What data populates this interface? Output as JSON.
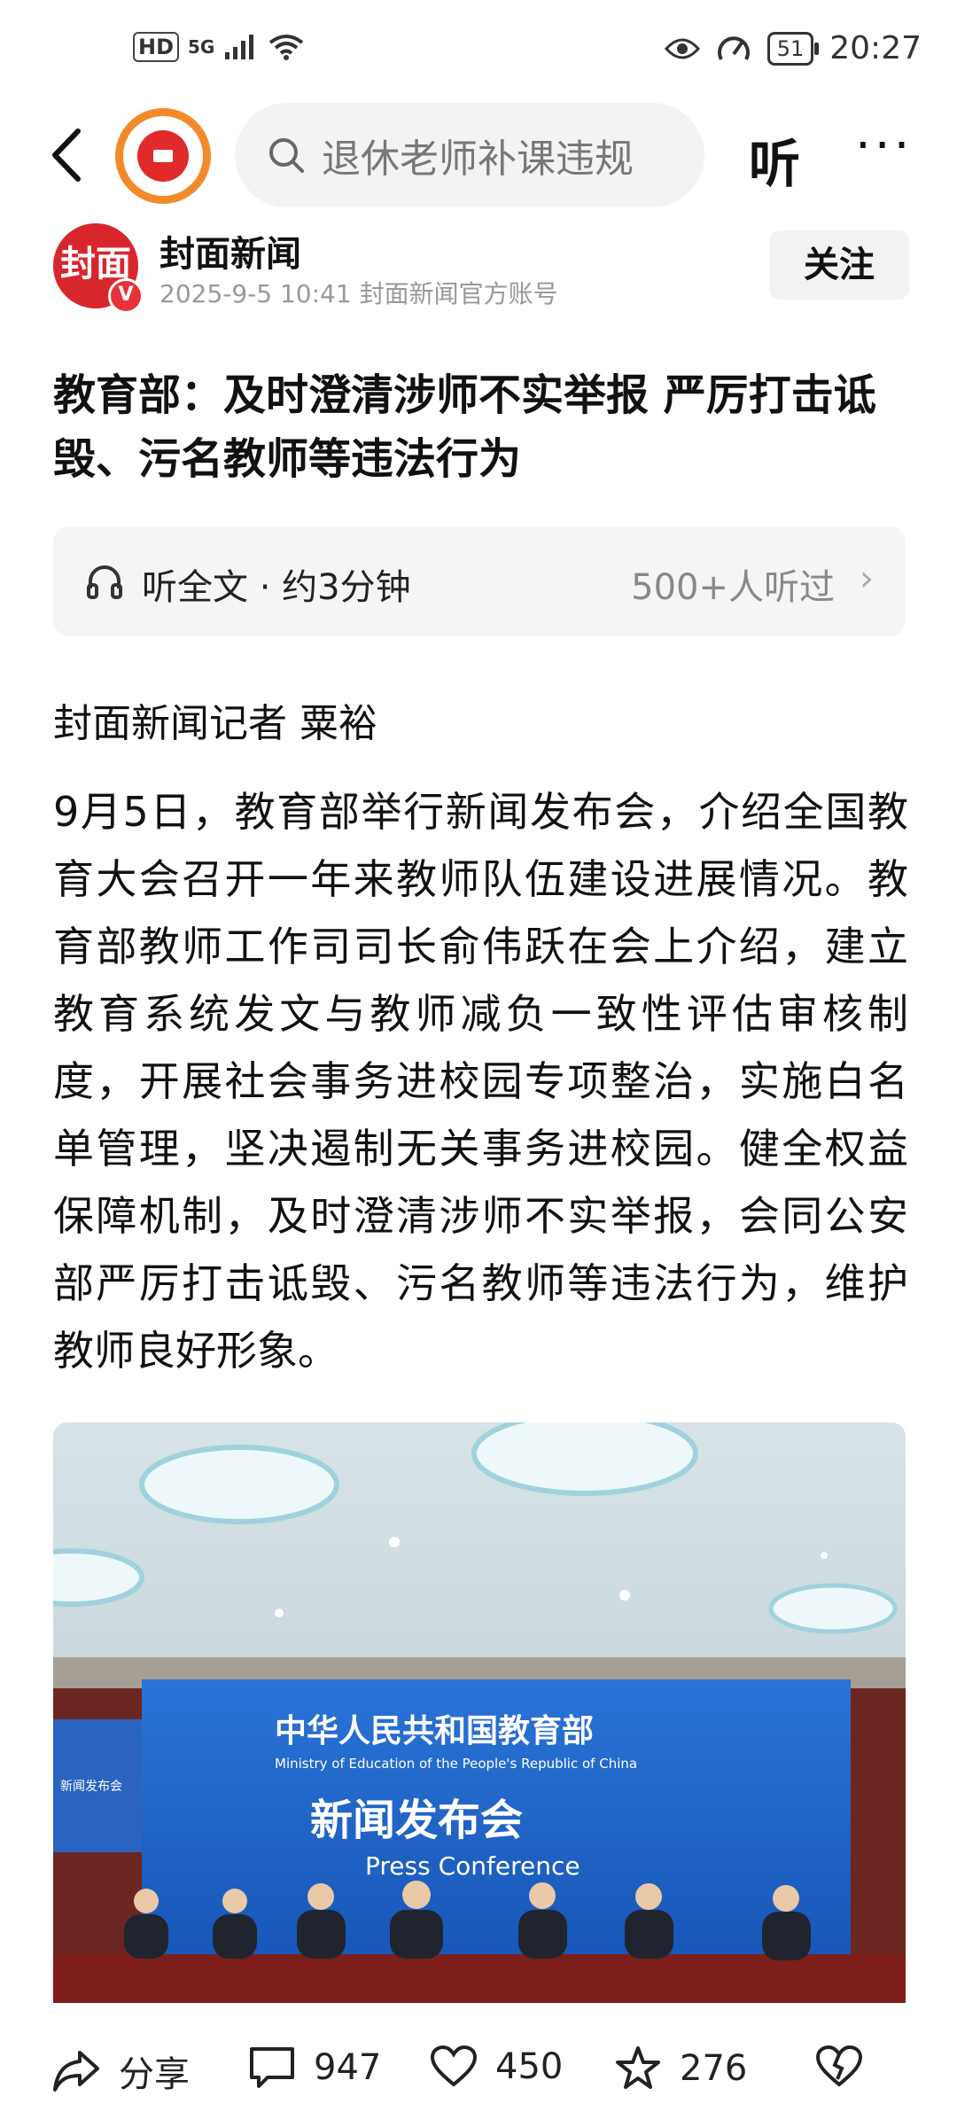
{
  "status_bar": {
    "hd": "HD",
    "network": "5G",
    "battery": "51",
    "time": "20:27"
  },
  "nav": {
    "search_text": "退休老师补课违规",
    "listen_label": "听",
    "more_label": "···"
  },
  "author": {
    "avatar_text": "封面",
    "name": "封面新闻",
    "meta": "2025-9-5 10:41   封面新闻官方账号",
    "follow_label": "关注",
    "verified_badge": "V"
  },
  "article": {
    "title": "教育部：及时澄清涉师不实举报 严厉打击诋毁、污名教师等违法行为",
    "listen_full": "听全文 · 约3分钟",
    "listen_count": "500+人听过",
    "reporter": "封面新闻记者 粟裕",
    "paragraph": "9月5日，教育部举行新闻发布会，介绍全国教育大会召开一年来教师队伍建设进展情况。教育部教师工作司司长俞伟跃在会上介绍，建立教育系统发文与教师减负一致性评估审核制度，开展社会事务进校园专项整治，实施白名单管理，坚决遏制无关事务进校园。健全权益保障机制，及时澄清涉师不实举报，会同公安部严厉打击诋毁、污名教师等违法行为，维护教师良好形象。"
  },
  "photo": {
    "banner_cn": "中华人民共和国教育部",
    "banner_en": "Ministry of Education of the People's Republic of China",
    "event_cn": "新闻发布会",
    "event_en": "Press Conference",
    "side_banner_small": "新闻发布会"
  },
  "bottom_bar": {
    "share_label": "分享",
    "comment_count": "947",
    "like_count": "450",
    "favorite_count": "276"
  },
  "colors": {
    "accent_red": "#d8262d",
    "logo_orange": "#f28a2c",
    "banner_blue": "#1f63c9"
  }
}
